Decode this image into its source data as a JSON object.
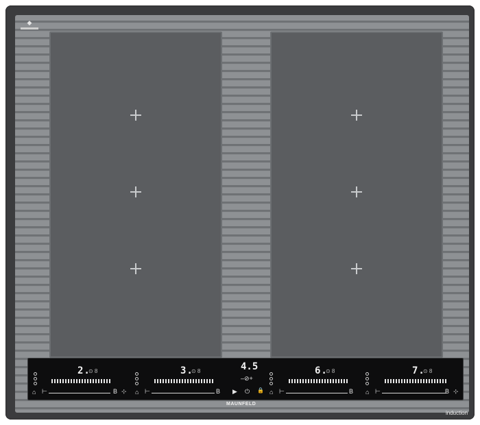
{
  "brand": "MAUNFELD",
  "induction_label": "induction",
  "center_timer": "4.5",
  "center_minus_plus": "–⊘+",
  "zones": [
    {
      "level": "2."
    },
    {
      "level": "3."
    },
    {
      "level": "6."
    },
    {
      "level": "7."
    }
  ],
  "boost_label": "B",
  "icons": {
    "play": "▶",
    "power": "⏻",
    "lock": "🔒"
  }
}
